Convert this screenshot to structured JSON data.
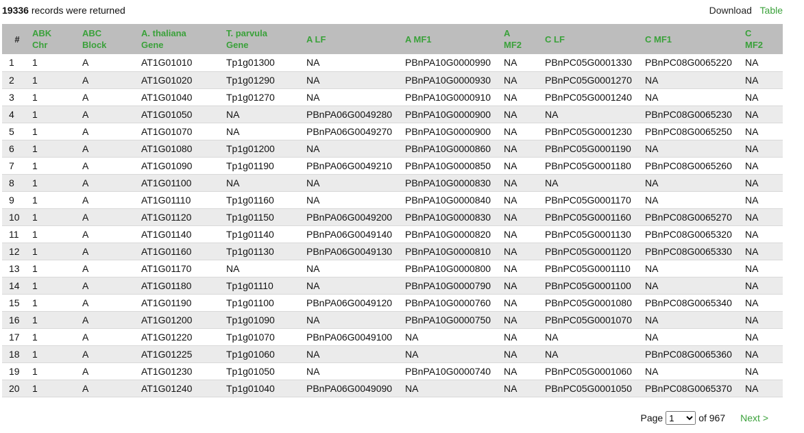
{
  "header": {
    "record_count": "19336",
    "records_text": " records were returned",
    "download_label": "Download",
    "table_label": "Table"
  },
  "table": {
    "columns": [
      {
        "l1": "#",
        "l2": ""
      },
      {
        "l1": "ABK",
        "l2": "Chr"
      },
      {
        "l1": "ABC",
        "l2": "Block"
      },
      {
        "l1": "A. thaliana",
        "l2": "Gene"
      },
      {
        "l1": "T. parvula",
        "l2": "Gene"
      },
      {
        "l1": "A LF",
        "l2": ""
      },
      {
        "l1": "A MF1",
        "l2": ""
      },
      {
        "l1": "A",
        "l2": "MF2"
      },
      {
        "l1": "C LF",
        "l2": ""
      },
      {
        "l1": "C MF1",
        "l2": ""
      },
      {
        "l1": "C",
        "l2": "MF2"
      }
    ],
    "rows": [
      [
        "1",
        "1",
        "A",
        "AT1G01010",
        "Tp1g01300",
        "NA",
        "PBnPA10G0000990",
        "NA",
        "PBnPC05G0001330",
        "PBnPC08G0065220",
        "NA"
      ],
      [
        "2",
        "1",
        "A",
        "AT1G01020",
        "Tp1g01290",
        "NA",
        "PBnPA10G0000930",
        "NA",
        "PBnPC05G0001270",
        "NA",
        "NA"
      ],
      [
        "3",
        "1",
        "A",
        "AT1G01040",
        "Tp1g01270",
        "NA",
        "PBnPA10G0000910",
        "NA",
        "PBnPC05G0001240",
        "NA",
        "NA"
      ],
      [
        "4",
        "1",
        "A",
        "AT1G01050",
        "NA",
        "PBnPA06G0049280",
        "PBnPA10G0000900",
        "NA",
        "NA",
        "PBnPC08G0065230",
        "NA"
      ],
      [
        "5",
        "1",
        "A",
        "AT1G01070",
        "NA",
        "PBnPA06G0049270",
        "PBnPA10G0000900",
        "NA",
        "PBnPC05G0001230",
        "PBnPC08G0065250",
        "NA"
      ],
      [
        "6",
        "1",
        "A",
        "AT1G01080",
        "Tp1g01200",
        "NA",
        "PBnPA10G0000860",
        "NA",
        "PBnPC05G0001190",
        "NA",
        "NA"
      ],
      [
        "7",
        "1",
        "A",
        "AT1G01090",
        "Tp1g01190",
        "PBnPA06G0049210",
        "PBnPA10G0000850",
        "NA",
        "PBnPC05G0001180",
        "PBnPC08G0065260",
        "NA"
      ],
      [
        "8",
        "1",
        "A",
        "AT1G01100",
        "NA",
        "NA",
        "PBnPA10G0000830",
        "NA",
        "NA",
        "NA",
        "NA"
      ],
      [
        "9",
        "1",
        "A",
        "AT1G01110",
        "Tp1g01160",
        "NA",
        "PBnPA10G0000840",
        "NA",
        "PBnPC05G0001170",
        "NA",
        "NA"
      ],
      [
        "10",
        "1",
        "A",
        "AT1G01120",
        "Tp1g01150",
        "PBnPA06G0049200",
        "PBnPA10G0000830",
        "NA",
        "PBnPC05G0001160",
        "PBnPC08G0065270",
        "NA"
      ],
      [
        "11",
        "1",
        "A",
        "AT1G01140",
        "Tp1g01140",
        "PBnPA06G0049140",
        "PBnPA10G0000820",
        "NA",
        "PBnPC05G0001130",
        "PBnPC08G0065320",
        "NA"
      ],
      [
        "12",
        "1",
        "A",
        "AT1G01160",
        "Tp1g01130",
        "PBnPA06G0049130",
        "PBnPA10G0000810",
        "NA",
        "PBnPC05G0001120",
        "PBnPC08G0065330",
        "NA"
      ],
      [
        "13",
        "1",
        "A",
        "AT1G01170",
        "NA",
        "NA",
        "PBnPA10G0000800",
        "NA",
        "PBnPC05G0001110",
        "NA",
        "NA"
      ],
      [
        "14",
        "1",
        "A",
        "AT1G01180",
        "Tp1g01110",
        "NA",
        "PBnPA10G0000790",
        "NA",
        "PBnPC05G0001100",
        "NA",
        "NA"
      ],
      [
        "15",
        "1",
        "A",
        "AT1G01190",
        "Tp1g01100",
        "PBnPA06G0049120",
        "PBnPA10G0000760",
        "NA",
        "PBnPC05G0001080",
        "PBnPC08G0065340",
        "NA"
      ],
      [
        "16",
        "1",
        "A",
        "AT1G01200",
        "Tp1g01090",
        "NA",
        "PBnPA10G0000750",
        "NA",
        "PBnPC05G0001070",
        "NA",
        "NA"
      ],
      [
        "17",
        "1",
        "A",
        "AT1G01220",
        "Tp1g01070",
        "PBnPA06G0049100",
        "NA",
        "NA",
        "NA",
        "NA",
        "NA"
      ],
      [
        "18",
        "1",
        "A",
        "AT1G01225",
        "Tp1g01060",
        "NA",
        "NA",
        "NA",
        "NA",
        "PBnPC08G0065360",
        "NA"
      ],
      [
        "19",
        "1",
        "A",
        "AT1G01230",
        "Tp1g01050",
        "NA",
        "PBnPA10G0000740",
        "NA",
        "PBnPC05G0001060",
        "NA",
        "NA"
      ],
      [
        "20",
        "1",
        "A",
        "AT1G01240",
        "Tp1g01040",
        "PBnPA06G0049090",
        "NA",
        "NA",
        "PBnPC05G0001050",
        "PBnPC08G0065370",
        "NA"
      ]
    ]
  },
  "pagination": {
    "page_label": "Page",
    "current_page": "1",
    "of_label": "of 967",
    "next_label": "Next >"
  },
  "colors": {
    "accent": "#3aa13a",
    "header_bg": "#bdbdbd",
    "row_alt": "#ebebeb"
  }
}
